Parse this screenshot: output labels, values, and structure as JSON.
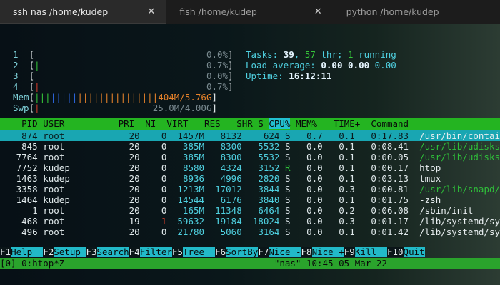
{
  "tabs": [
    {
      "title": "ssh nas /home/kudep",
      "active": true
    },
    {
      "title": "fish /home/kudep",
      "active": false
    },
    {
      "title": "python /home/kudep",
      "active": false
    }
  ],
  "tab_close_glyph": "✕",
  "meters": {
    "cpus": [
      {
        "id": "1",
        "value": "0.0%"
      },
      {
        "id": "2",
        "value": "0.7%"
      },
      {
        "id": "3",
        "value": "0.0%"
      },
      {
        "id": "4",
        "value": "0.7%"
      }
    ],
    "mem": {
      "label": "Mem",
      "value": "404M/5.76G"
    },
    "swp": {
      "label": "Swp",
      "value": "25.0M/4.00G"
    }
  },
  "summary": {
    "tasks_label": "Tasks:",
    "tasks": "39",
    "thr": "57",
    "thr_label": "thr;",
    "running": "1",
    "running_label": "running",
    "load_label": "Load average:",
    "load1": "0.00",
    "load5": "0.00",
    "load15": "0.00",
    "uptime_label": "Uptime:",
    "uptime": "16:12:11"
  },
  "columns": [
    "PID",
    "USER",
    "PRI",
    "NI",
    "VIRT",
    "RES",
    "SHR",
    "S",
    "CPU%",
    "MEM%",
    "TIME+",
    "Command"
  ],
  "processes": [
    {
      "pid": "874",
      "user": "root",
      "pri": "20",
      "ni": "0",
      "virt": "1457M",
      "res": "8132",
      "shr": "624",
      "s": "S",
      "cpu": "0.7",
      "mem": "0.1",
      "time": "0:17.83",
      "cmd": "/usr/bin/contai"
    },
    {
      "pid": "845",
      "user": "root",
      "pri": "20",
      "ni": "0",
      "virt": "385M",
      "res": "8300",
      "shr": "5532",
      "s": "S",
      "cpu": "0.0",
      "mem": "0.1",
      "time": "0:08.41",
      "cmd": "/usr/lib/udisks"
    },
    {
      "pid": "7764",
      "user": "root",
      "pri": "20",
      "ni": "0",
      "virt": "385M",
      "res": "8300",
      "shr": "5532",
      "s": "S",
      "cpu": "0.0",
      "mem": "0.1",
      "time": "0:00.05",
      "cmd": "/usr/lib/udisks"
    },
    {
      "pid": "7752",
      "user": "kudep",
      "pri": "20",
      "ni": "0",
      "virt": "8580",
      "res": "4324",
      "shr": "3152",
      "s": "R",
      "cpu": "0.0",
      "mem": "0.1",
      "time": "0:00.17",
      "cmd": "htop"
    },
    {
      "pid": "1463",
      "user": "kudep",
      "pri": "20",
      "ni": "0",
      "virt": "8936",
      "res": "4996",
      "shr": "2820",
      "s": "S",
      "cpu": "0.0",
      "mem": "0.1",
      "time": "0:03.13",
      "cmd": "tmux"
    },
    {
      "pid": "3358",
      "user": "root",
      "pri": "20",
      "ni": "0",
      "virt": "1213M",
      "res": "17012",
      "shr": "3844",
      "s": "S",
      "cpu": "0.0",
      "mem": "0.3",
      "time": "0:00.81",
      "cmd": "/usr/lib/snapd/"
    },
    {
      "pid": "1464",
      "user": "kudep",
      "pri": "20",
      "ni": "0",
      "virt": "14544",
      "res": "6176",
      "shr": "3840",
      "s": "S",
      "cpu": "0.0",
      "mem": "0.1",
      "time": "0:01.75",
      "cmd": "-zsh"
    },
    {
      "pid": "1",
      "user": "root",
      "pri": "20",
      "ni": "0",
      "virt": "165M",
      "res": "11348",
      "shr": "6464",
      "s": "S",
      "cpu": "0.0",
      "mem": "0.2",
      "time": "0:06.08",
      "cmd": "/sbin/init"
    },
    {
      "pid": "468",
      "user": "root",
      "pri": "19",
      "ni": "-1",
      "virt": "59632",
      "res": "19184",
      "shr": "18024",
      "s": "S",
      "cpu": "0.0",
      "mem": "0.3",
      "time": "0:01.17",
      "cmd": "/lib/systemd/sy"
    },
    {
      "pid": "496",
      "user": "root",
      "pri": "20",
      "ni": "0",
      "virt": "21780",
      "res": "5060",
      "shr": "3164",
      "s": "S",
      "cpu": "0.0",
      "mem": "0.1",
      "time": "0:01.42",
      "cmd": "/lib/systemd/sy"
    }
  ],
  "fkeys": [
    {
      "key": "F1",
      "label": "Help  "
    },
    {
      "key": "F2",
      "label": "Setup "
    },
    {
      "key": "F3",
      "label": "Search"
    },
    {
      "key": "F4",
      "label": "Filter"
    },
    {
      "key": "F5",
      "label": "Tree  "
    },
    {
      "key": "F6",
      "label": "SortBy"
    },
    {
      "key": "F7",
      "label": "Nice -"
    },
    {
      "key": "F8",
      "label": "Nice +"
    },
    {
      "key": "F9",
      "label": "Kill  "
    },
    {
      "key": "F10",
      "label": "Quit"
    }
  ],
  "tmux": {
    "session": "[0] 0:htop*Z",
    "host": "\"nas\"",
    "clock": "10:45 05-Mar-22"
  },
  "colors": {
    "header_bg": "#24b421",
    "selected_bg": "#19a6b2",
    "tmux_bg": "#2aa32c"
  }
}
